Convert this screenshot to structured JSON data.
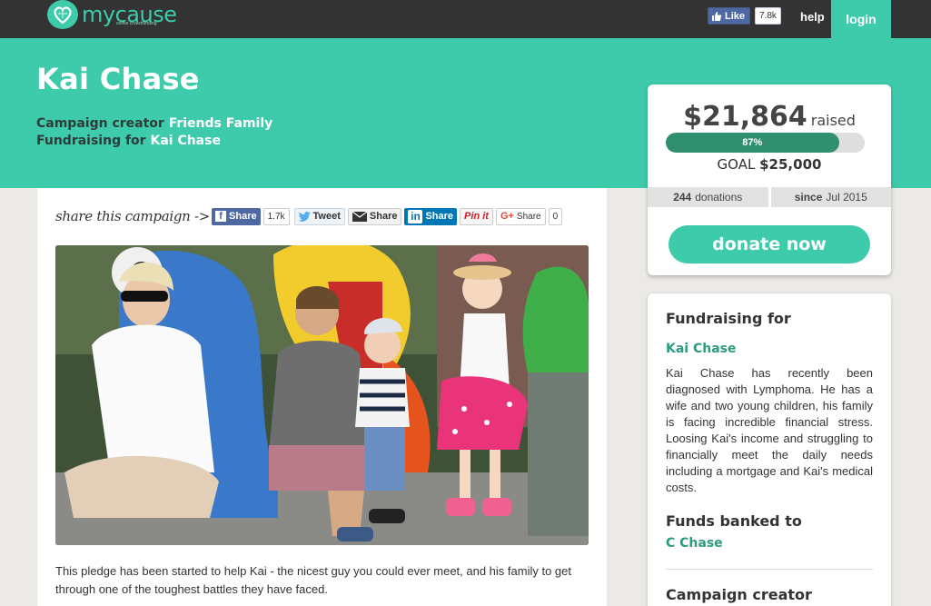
{
  "brand": {
    "name": "mycause",
    "tagline": "online crowdfunding",
    "accent": "#3ecbab"
  },
  "topbar": {
    "like_label": "Like",
    "like_count": "7.8k",
    "help": "help",
    "login": "login"
  },
  "hero": {
    "title": "Kai Chase",
    "creator_label": "Campaign creator",
    "creator_name": "Friends Family",
    "for_label": "Fundraising for",
    "for_name": "Kai Chase"
  },
  "share": {
    "label": "share this campaign ->",
    "facebook": "Share",
    "facebook_count": "1.7k",
    "twitter": "Tweet",
    "email": "Share",
    "linkedin": "Share",
    "pinterest": "Pin it",
    "google": "Share",
    "google_count": "0"
  },
  "story": {
    "text": "This pledge has been started to help Kai - the nicest guy you could ever meet, and his family to get through one of the toughest battles they have faced."
  },
  "stats": {
    "raised": "$21,864",
    "raised_label": "raised",
    "progress_percent": 87,
    "progress_label": "87%",
    "goal_label": "GOAL",
    "goal": "$25,000",
    "donations_count": "244",
    "donations_label": "donations",
    "since_label": "since",
    "since_date": "Jul 2015",
    "donate_button": "donate now"
  },
  "info": {
    "fundraising_for_heading": "Fundraising for",
    "fundraising_for_name": "Kai Chase",
    "description": "Kai Chase has recently been diagnosed with Lymphoma. He has a wife and two young children, his family is facing incredible financial stress. Loosing Kai's income and struggling to financially meet the daily needs including a mortgage and Kai's medical costs.",
    "funds_heading": "Funds banked to",
    "funds_name": "C Chase",
    "creator_heading": "Campaign creator"
  }
}
